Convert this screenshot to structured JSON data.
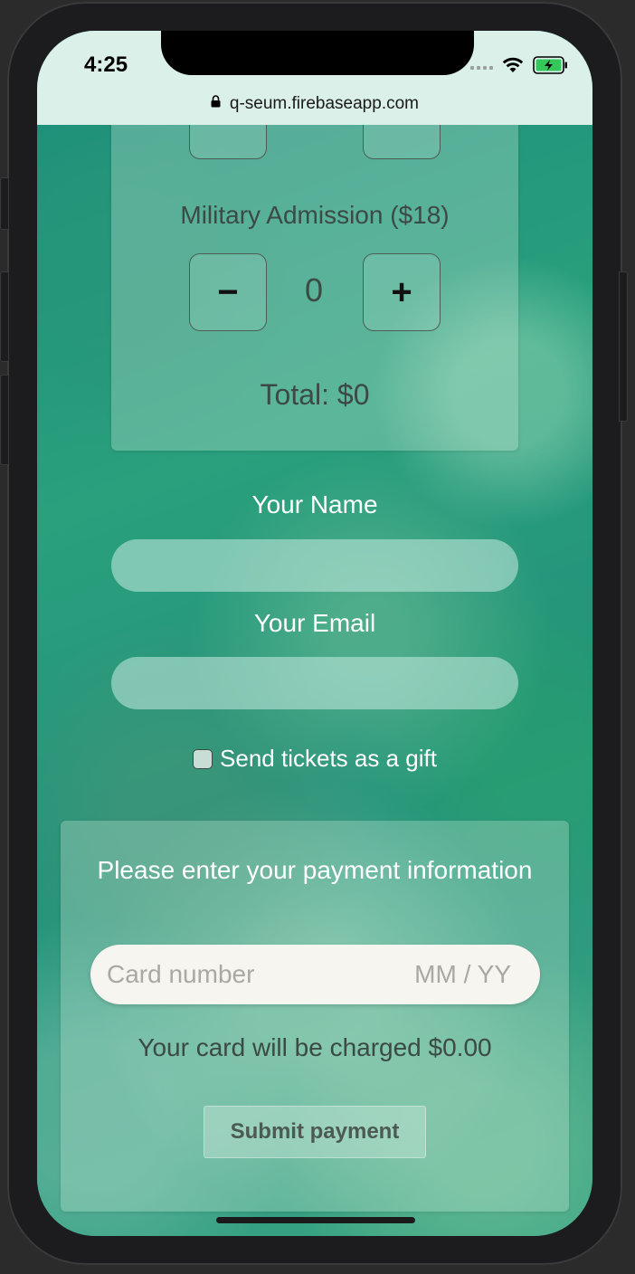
{
  "status_bar": {
    "time": "4:25",
    "url": "q-seum.firebaseapp.com"
  },
  "tickets": {
    "military_label": "Military Admission ($18)",
    "decrement_label": "−",
    "increment_label": "+",
    "military_count": "0",
    "total": "Total: $0"
  },
  "form": {
    "name_label": "Your Name",
    "name_value": "",
    "email_label": "Your Email",
    "email_value": "",
    "gift_label": "Send tickets as a gift",
    "gift_checked": false
  },
  "payment": {
    "heading": "Please enter your payment information",
    "card_number_placeholder": "Card number",
    "expiry_placeholder": "MM / YY",
    "charge_text": "Your card will be charged $0.00",
    "submit_label": "Submit payment"
  },
  "colors": {
    "background_teal": "#1f8f76",
    "status_bar_bg": "#dcf0ea",
    "card_field_bg": "#f6f5ef"
  },
  "icons": {
    "lock": "lock-icon",
    "wifi": "wifi-icon",
    "battery": "battery-charging-icon",
    "signal": "signal-icon"
  }
}
